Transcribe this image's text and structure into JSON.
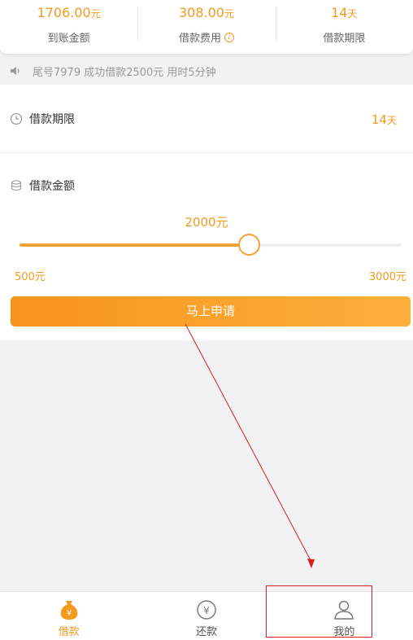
{
  "summary": [
    {
      "value": "1706.00",
      "unit": "元",
      "label": "到账金额"
    },
    {
      "value": "308.00",
      "unit": "元",
      "label": "借款费用"
    },
    {
      "value": "14",
      "unit": "天",
      "label": "借款期限"
    }
  ],
  "notice": "尾号7979 成功借款2500元 用时5分钟",
  "term": {
    "label": "借款期限",
    "value": "14",
    "unit": "天"
  },
  "amount": {
    "label": "借款金额",
    "current": "2000元",
    "min": "500元",
    "max": "3000元",
    "slider_fraction": 0.6
  },
  "apply_button": "马上申请",
  "tabs": [
    {
      "label": "借款",
      "icon": "money-bag-icon",
      "active": true
    },
    {
      "label": "还款",
      "icon": "yen-circle-icon",
      "active": false
    },
    {
      "label": "我的",
      "icon": "user-icon",
      "active": false
    }
  ],
  "colors": {
    "accent": "#f39a1f",
    "annotation": "#d81e1e"
  }
}
